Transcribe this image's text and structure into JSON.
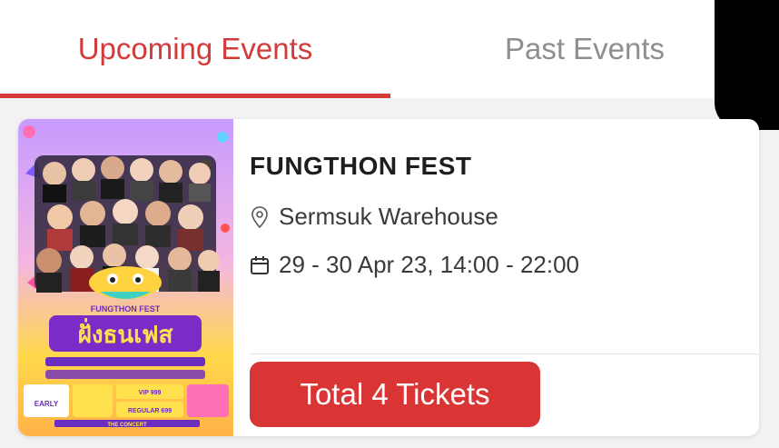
{
  "tabs": {
    "upcoming_label": "Upcoming Events",
    "past_label": "Past Events",
    "active_color": "#d33a3a",
    "inactive_color": "#8e8e8e"
  },
  "event": {
    "title": "FUNGTHON FEST",
    "location": "Sermsuk Warehouse",
    "datetime": "29 - 30 Apr 23, 14:00 - 22:00",
    "location_icon": "map-pin-icon",
    "date_icon": "calendar-icon",
    "poster": {
      "brand": "FUNGTHON FEST",
      "thai_title": "ฝั่งธนเฟส",
      "early_label": "EARLY",
      "vip_label": "VIP 999",
      "regular_label": "REGULAR 699",
      "concert_label": "THE CONCERT"
    }
  },
  "tickets_button": {
    "label": "Total 4 Tickets",
    "color": "#d93535"
  }
}
